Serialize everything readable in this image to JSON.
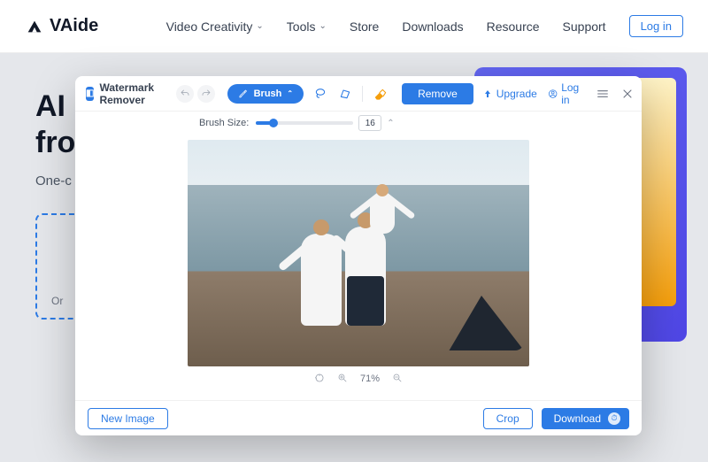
{
  "header": {
    "brand": "VAide",
    "nav": {
      "video_creativity": "Video Creativity",
      "tools": "Tools",
      "store": "Store",
      "downloads": "Downloads",
      "resource": "Resource",
      "support": "Support"
    },
    "login": "Log in"
  },
  "hero": {
    "title_line1": "AI P",
    "title_line2": "fron",
    "subtitle": "One-c                                         photo",
    "dropzone_hint": "Or"
  },
  "modal": {
    "app_title": "Watermark Remover",
    "tools": {
      "brush_label": "Brush",
      "brush_size_label": "Brush Size:",
      "brush_size_value": "16"
    },
    "remove": "Remove",
    "upgrade": "Upgrade",
    "login": "Log in",
    "zoom": "71%",
    "new_image": "New Image",
    "crop": "Crop",
    "download": "Download"
  }
}
